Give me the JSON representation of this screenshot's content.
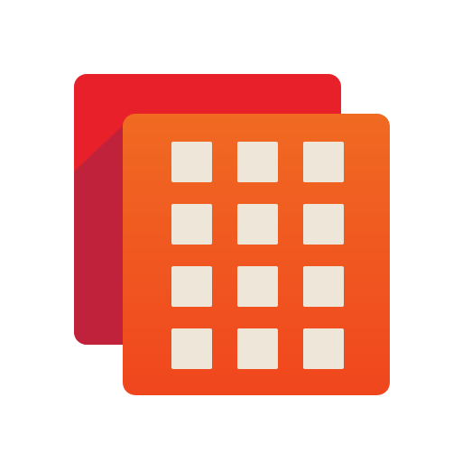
{
  "icon": {
    "name": "grid-stack-app-icon",
    "grid_rows": 4,
    "grid_cols": 3
  },
  "colors": {
    "background": "#ffffff",
    "back_card_top": "#e8202a",
    "back_card_shadow": "#c0223c",
    "front_card_top": "#f06a22",
    "front_card_bottom": "#f0461e",
    "tile": "#efe6da"
  }
}
